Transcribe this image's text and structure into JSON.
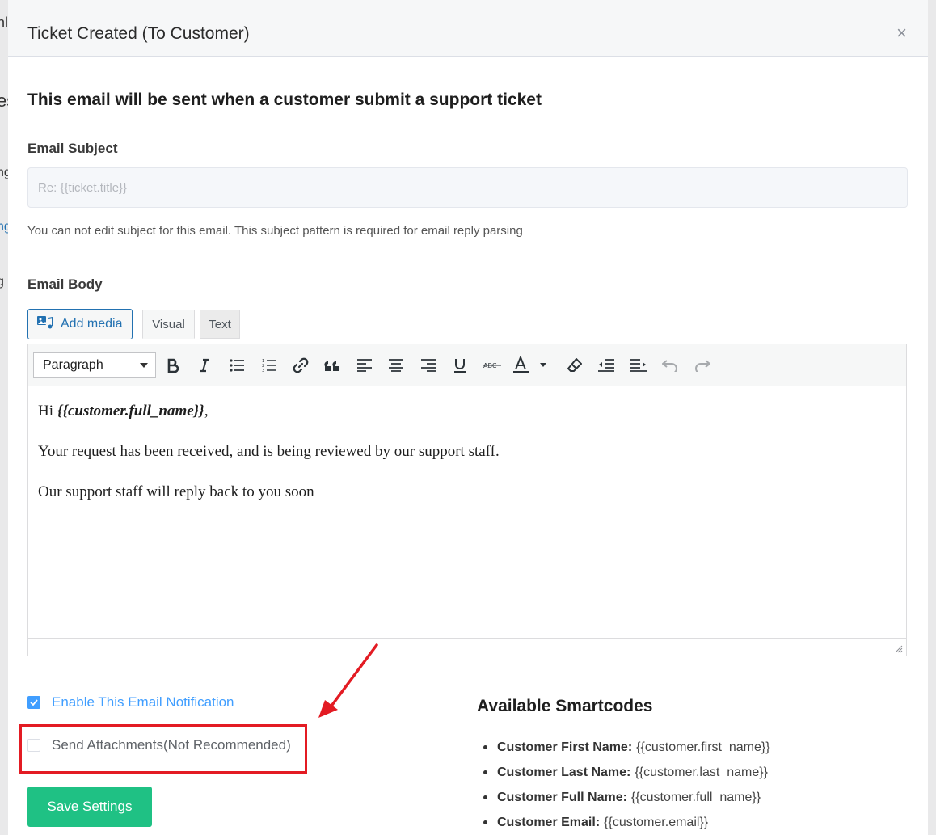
{
  "background": {
    "left_fragments": [
      "nl",
      "es",
      "ng",
      "ng",
      "g"
    ]
  },
  "modal": {
    "title": "Ticket Created (To Customer)",
    "close_glyph": "×"
  },
  "headline": "This email will be sent when a customer submit a support ticket",
  "subject": {
    "label": "Email Subject",
    "placeholder": "Re: {{ticket.title}}",
    "value": "",
    "help_text": "You can not edit subject for this email. This subject pattern is required for email reply parsing"
  },
  "body": {
    "label": "Email Body",
    "add_media_label": "Add media",
    "tabs": [
      {
        "label": "Visual",
        "active": true
      },
      {
        "label": "Text",
        "active": false
      }
    ],
    "format_select": "Paragraph",
    "toolbar_icons": [
      "bold-icon",
      "italic-icon",
      "bulleted-list-icon",
      "numbered-list-icon",
      "link-icon",
      "blockquote-icon",
      "align-left-icon",
      "align-center-icon",
      "align-right-icon",
      "underline-icon",
      "strikethrough-icon",
      "text-color-icon",
      "clear-formatting-icon",
      "outdent-icon",
      "indent-icon",
      "undo-icon",
      "redo-icon"
    ],
    "content": {
      "greeting_prefix": "Hi ",
      "greeting_code": "{{customer.full_name}}",
      "greeting_suffix": ",",
      "line2": "Your request has been received, and is being reviewed by our support staff.",
      "line3": "Our support staff will reply back to you soon"
    }
  },
  "options": {
    "enable_label": "Enable This Email Notification",
    "enable_checked": true,
    "attachments_label": "Send Attachments(Not Recommended)",
    "attachments_checked": false
  },
  "save_button": "Save Settings",
  "smartcodes": {
    "title": "Available Smartcodes",
    "items": [
      {
        "name": "Customer First Name:",
        "code": "{{customer.first_name}}"
      },
      {
        "name": "Customer Last Name:",
        "code": "{{customer.last_name}}"
      },
      {
        "name": "Customer Full Name:",
        "code": "{{customer.full_name}}"
      },
      {
        "name": "Customer Email:",
        "code": "{{customer.email}}"
      }
    ]
  },
  "colors": {
    "accent_blue": "#409eff",
    "wp_blue": "#2271b1",
    "save_green": "#1fc184",
    "annotation_red": "#e31b23"
  }
}
